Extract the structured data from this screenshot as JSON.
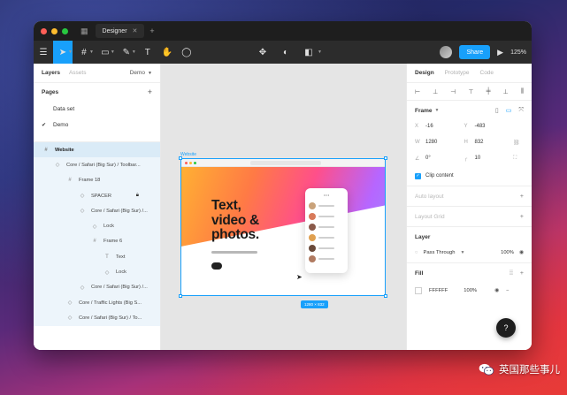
{
  "titlebar": {
    "tab_title": "Designer"
  },
  "colors": {
    "accent": "#18a0fb",
    "toolbar_bg": "#2c2c2c",
    "titlebar_bg": "#1e1e1e",
    "selection_bg": "#daebf7"
  },
  "toolbar": {
    "tools": [
      {
        "name": "menu-icon",
        "glyph": "☰"
      },
      {
        "name": "move-tool-icon",
        "glyph": "➤"
      },
      {
        "name": "frame-tool-icon",
        "glyph": "#"
      },
      {
        "name": "shape-tool-icon",
        "glyph": "▭"
      },
      {
        "name": "pen-tool-icon",
        "glyph": "✎"
      },
      {
        "name": "text-tool-icon",
        "glyph": "T"
      },
      {
        "name": "hand-tool-icon",
        "glyph": "✋"
      },
      {
        "name": "comment-tool-icon",
        "glyph": "◯"
      }
    ],
    "share_label": "Share",
    "zoom_label": "125%"
  },
  "left_panel": {
    "tabs": {
      "layers": "Layers",
      "assets": "Assets"
    },
    "page_select": "Demo",
    "pages_title": "Pages",
    "pages": [
      {
        "label": "Data set",
        "current": false
      },
      {
        "label": "Demo",
        "current": true
      }
    ],
    "layers": [
      {
        "label": "Website",
        "depth": 0,
        "icon": "#",
        "selected": true
      },
      {
        "label": "Core / Safari (Big Sur) / Toolbar...",
        "depth": 1,
        "icon": "◇"
      },
      {
        "label": "Frame 18",
        "depth": 2,
        "icon": "#"
      },
      {
        "label": "SPACER",
        "depth": 3,
        "icon": "◇",
        "locked": true
      },
      {
        "label": "Core / Safari (Big Sur) /...",
        "depth": 3,
        "icon": "◇"
      },
      {
        "label": "Lock",
        "depth": 4,
        "icon": "◇"
      },
      {
        "label": "Frame 6",
        "depth": 4,
        "icon": "#"
      },
      {
        "label": "Text",
        "depth": 5,
        "icon": "T"
      },
      {
        "label": "Lock",
        "depth": 5,
        "icon": "◇"
      },
      {
        "label": "Core / Safari (Big Sur) /...",
        "depth": 3,
        "icon": "◇"
      },
      {
        "label": "Core / Traffic Lights (Big S...",
        "depth": 2,
        "icon": "◇"
      },
      {
        "label": "Core / Safari (Big Sur) / To...",
        "depth": 2,
        "icon": "◇"
      }
    ]
  },
  "canvas": {
    "frame_label": "Website",
    "hero_title": "Text,\nvideo &\nphotos.",
    "size_badge": "1280 × 832"
  },
  "right_panel": {
    "tabs": {
      "design": "Design",
      "prototype": "Prototype",
      "code": "Code"
    },
    "frame_title": "Frame",
    "fields": {
      "x": "-16",
      "y": "-483",
      "w": "1280",
      "h": "832",
      "rotation": "0°",
      "radius": "10"
    },
    "field_keys": {
      "x": "X",
      "y": "Y",
      "w": "W",
      "h": "H"
    },
    "clip_content": "Clip content",
    "auto_layout": "Auto layout",
    "layout_grid": "Layout Grid",
    "layer_title": "Layer",
    "blend_mode": "Pass Through",
    "layer_opacity": "100%",
    "fill_title": "Fill",
    "fill_hex": "FFFFFF",
    "fill_opacity": "100%"
  },
  "watermark": {
    "text": "英国那些事儿"
  }
}
